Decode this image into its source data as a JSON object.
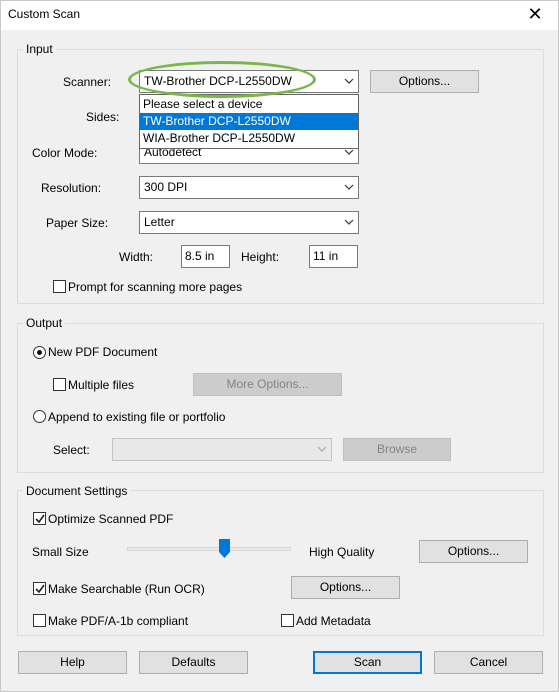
{
  "window": {
    "title": "Custom Scan",
    "close_glyph": "✕"
  },
  "input": {
    "group_label": "Input",
    "scanner_label": "Scanner:",
    "scanner_value": "TW-Brother DCP-L2550DW",
    "scanner_options_button": "Options...",
    "dropdown_items": [
      "Please select a device",
      "TW-Brother DCP-L2550DW",
      "WIA-Brother DCP-L2550DW"
    ],
    "dropdown_selected_index": 1,
    "sides_label": "Sides:",
    "color_mode_label": "Color Mode:",
    "color_mode_value": "Autodetect",
    "resolution_label": "Resolution:",
    "resolution_value": "300 DPI",
    "paper_size_label": "Paper Size:",
    "paper_size_value": "Letter",
    "width_label": "Width:",
    "width_value": "8.5 in",
    "height_label": "Height:",
    "height_value": "11 in",
    "prompt_more_pages_label": "Prompt for scanning more pages",
    "prompt_more_pages_checked": false
  },
  "output": {
    "group_label": "Output",
    "new_pdf_label": "New PDF Document",
    "new_pdf_selected": true,
    "multiple_files_label": "Multiple files",
    "multiple_files_checked": false,
    "more_options_button": "More Options...",
    "append_label": "Append to existing file or portfolio",
    "append_selected": false,
    "select_label": "Select:",
    "select_value": "",
    "browse_button": "Browse"
  },
  "document_settings": {
    "group_label": "Document Settings",
    "optimize_label": "Optimize Scanned PDF",
    "optimize_checked": true,
    "small_size_label": "Small Size",
    "high_quality_label": "High Quality",
    "quality_level_fraction": 0.6,
    "optimize_options_button": "Options...",
    "make_searchable_label": "Make Searchable (Run OCR)",
    "make_searchable_checked": true,
    "ocr_options_button": "Options...",
    "pdfa_label": "Make PDF/A-1b compliant",
    "pdfa_checked": false,
    "add_metadata_label": "Add Metadata",
    "add_metadata_checked": false
  },
  "footer": {
    "help_button": "Help",
    "defaults_button": "Defaults",
    "scan_button": "Scan",
    "cancel_button": "Cancel"
  },
  "colors": {
    "selection": "#0078d7",
    "highlight_oval": "#7ab648",
    "slider_thumb": "#0078d7"
  }
}
